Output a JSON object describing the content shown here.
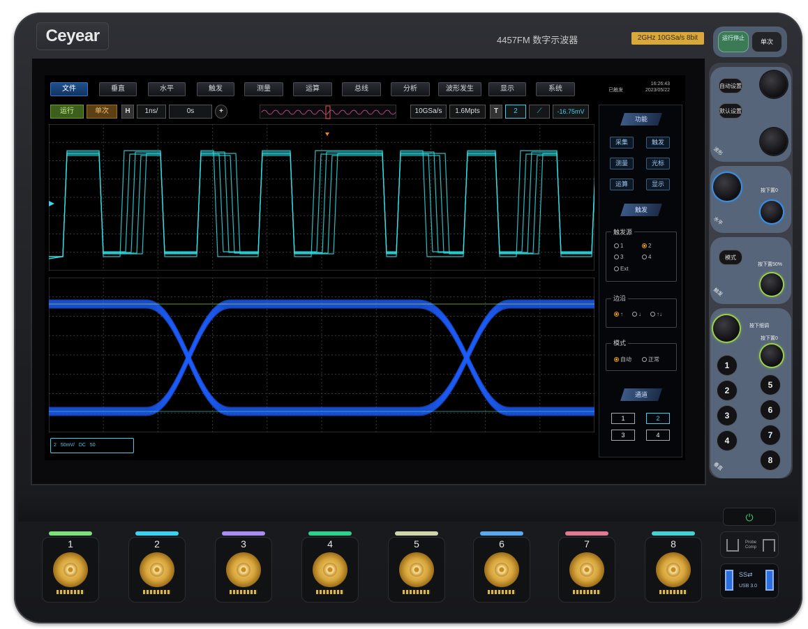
{
  "brand": {
    "logo_text": "Ceyear",
    "model": "4457FM 数字示波器",
    "spec_badge": "2GHz 10GSa/s 8bit"
  },
  "top_buttons": {
    "run_stop": "运行停止",
    "single": "单次"
  },
  "menu": [
    "文件",
    "垂直",
    "水平",
    "触发",
    "测量",
    "运算",
    "总线",
    "分析",
    "波形发生",
    "显示",
    "系统"
  ],
  "status": {
    "label": "已触发",
    "time": "16:26:43",
    "date": "2023/05/22"
  },
  "toolbar": {
    "run": "运行",
    "single": "单次",
    "h_label": "H",
    "timebase": "1ns/",
    "offset": "0s",
    "sample_rate": "10GSa/s",
    "mem_depth": "1.6Mpts",
    "t_label": "T",
    "trig_channel": "2",
    "trig_level": "-16.75mV"
  },
  "channel_info": {
    "channel": "2",
    "scale": "50mV/",
    "coupling": "DC",
    "impedance": "50"
  },
  "side_panel": {
    "function_head": "功能",
    "function_buttons": [
      "采集",
      "触发",
      "测量",
      "光标",
      "运算",
      "显示"
    ],
    "trigger_head": "触发",
    "source_title": "触发源",
    "sources": [
      "1",
      "2",
      "3",
      "4",
      "Ext"
    ],
    "selected_source": "2",
    "edge_title": "边沿",
    "edges": [
      "↑",
      "↓",
      "↑↓"
    ],
    "mode_title": "模式",
    "modes": [
      "自动",
      "正常"
    ],
    "channel_head": "通道",
    "channel_buttons": [
      "1",
      "2",
      "3",
      "4"
    ]
  },
  "right_panel": {
    "auto_set": "自动设置",
    "default_set": "默认设置",
    "mode_btn": "模式",
    "press_zero": "按下置0",
    "press_50": "按下置50%",
    "press_fine": "按下细调",
    "section_labels": [
      "波形",
      "水平",
      "触发",
      "垂直"
    ],
    "number_buttons": [
      "1",
      "2",
      "3",
      "4",
      "5",
      "6",
      "7",
      "8"
    ]
  },
  "front": {
    "channels": [
      {
        "label": "1",
        "color": "#7ee07a"
      },
      {
        "label": "2",
        "color": "#3fd0f0"
      },
      {
        "label": "3",
        "color": "#a98df0"
      },
      {
        "label": "4",
        "color": "#2fd08a"
      },
      {
        "label": "5",
        "color": "#d0d6a8"
      },
      {
        "label": "6",
        "color": "#5aa8f0"
      },
      {
        "label": "7",
        "color": "#e07a8e"
      },
      {
        "label": "8",
        "color": "#48d0d0"
      }
    ],
    "probe_comp": "Probe Comp",
    "usb_label": "USB 3.0",
    "usb_logo": "SS⇄"
  },
  "colors": {
    "waveform": "#2fe0e8",
    "eye": "#1e5eff",
    "eye_hot": "#b0ff40",
    "grid": "#3a3a3a"
  }
}
